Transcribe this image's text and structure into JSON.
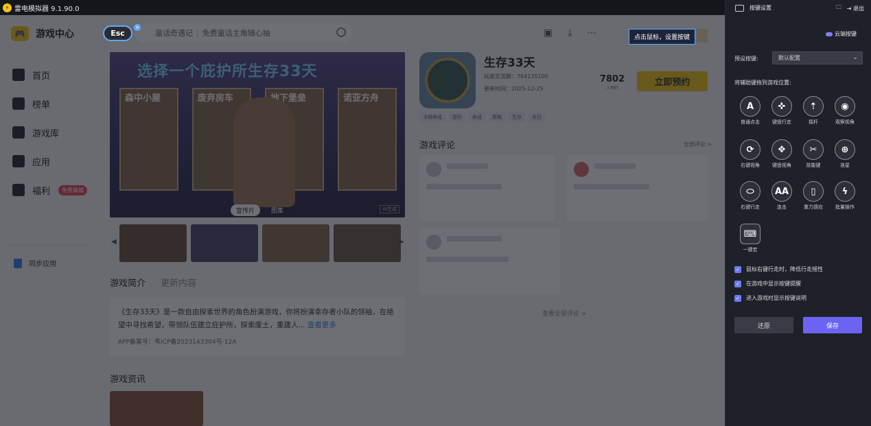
{
  "app": {
    "title": "雷电模拟器 9.1.90.0"
  },
  "sidebar": {
    "brand": "游戏中心",
    "items": [
      {
        "label": "首页"
      },
      {
        "label": "榜单"
      },
      {
        "label": "游戏库"
      },
      {
        "label": "应用"
      },
      {
        "label": "福利",
        "badge": "免费商城"
      }
    ],
    "sync": "同步应用"
  },
  "search": {
    "title": "童话奇遇记",
    "placeholder": "免费童话主角随心抽"
  },
  "esc_key": "Esc",
  "tooltip": "点击鼠标，设置按键",
  "banner": {
    "headline": "选择一个庇护所生存33天",
    "cards": [
      "森中小屋",
      "废弃房车",
      "地下堡垒",
      "诺亚方舟"
    ],
    "tabs": [
      "宣传片",
      "图集"
    ],
    "ai_note": "AI生成"
  },
  "game": {
    "title": "生存33天",
    "qq_group": "玩家交流群：764135100",
    "update_time": "更新时间：2025-12-25",
    "reserve_count": "7802",
    "reserve_count_label": "人预约",
    "reserve_button": "立即预约",
    "tags": [
      "卡牌养成",
      "冒险",
      "养成",
      "策略",
      "生存",
      "末日"
    ]
  },
  "reviews": {
    "title": "游戏评论",
    "more": "全部评论 >",
    "all": "查看全部评论 >"
  },
  "intro_tabs": [
    "游戏简介",
    "更新内容"
  ],
  "intro": {
    "text": "《生存33天》是一款自由探索世界的角色扮演游戏，你将扮演幸存者小队的领袖，在绝望中寻找希望，带领队伍建立庇护所，探索废土，重建人...",
    "more": "查看更多",
    "icp": "APP备案号：粤ICP备2023143304号-12A"
  },
  "news": {
    "title": "游戏资讯"
  },
  "panel": {
    "title": "按键设置",
    "exit": "退出",
    "cloud": "云端按键",
    "preset_label": "预设按键:",
    "preset_value": "默认配置",
    "drag_label": "将辅助键拖到游戏位置:",
    "keys": [
      {
        "symbol": "A",
        "label": "普通点击"
      },
      {
        "symbol": "✜",
        "label": "键盘行走"
      },
      {
        "symbol": "⇡",
        "label": "摇杆"
      },
      {
        "symbol": "◉",
        "label": "观察视角"
      },
      {
        "symbol": "⟳",
        "label": "右键视角"
      },
      {
        "symbol": "✥",
        "label": "键盘视角"
      },
      {
        "symbol": "✂",
        "label": "技能键"
      },
      {
        "symbol": "⊕",
        "label": "准星"
      },
      {
        "symbol": "⬭",
        "label": "右键行走"
      },
      {
        "symbol": "AA",
        "label": "连击"
      },
      {
        "symbol": "▯",
        "label": "重力感应"
      },
      {
        "symbol": "ϟ",
        "label": "批量操作"
      },
      {
        "symbol": "⌨",
        "label": "一键宏"
      }
    ],
    "options": [
      "鼠标右键行走时，降低行走摇性",
      "在游戏中显示按键提醒",
      "进入游戏时显示按键说明"
    ],
    "reset": "还原",
    "save": "保存"
  },
  "colors": {
    "accent": "#6c63f3",
    "reserve": "#f5c518",
    "highlight": "#5fa9ff"
  }
}
